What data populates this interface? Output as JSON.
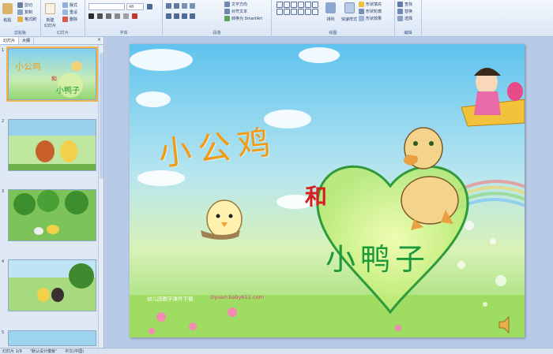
{
  "ribbon": {
    "clipboard": {
      "paste": "粘贴",
      "cut": "剪切",
      "copy": "复制",
      "format_painter": "格式刷",
      "label": "剪贴板"
    },
    "slides": {
      "new_slide": "新建\n幻灯片",
      "layout": "版式",
      "reset": "重设",
      "delete": "删除",
      "label": "幻灯片"
    },
    "font": {
      "size_value": "48",
      "label": "字体"
    },
    "paragraph": {
      "text_direction": "文字方向",
      "align_text": "对齐文本",
      "convert_smartart": "转换为 SmartArt",
      "label": "段落"
    },
    "drawing": {
      "arrange": "排列",
      "quick_styles": "快速样式",
      "shape_fill": "形状填充",
      "shape_outline": "形状轮廓",
      "shape_effects": "形状效果",
      "label": "绘图"
    },
    "editing": {
      "find": "查找",
      "replace": "替换",
      "select": "选择",
      "label": "编辑"
    }
  },
  "pane": {
    "tabs": [
      "幻灯片",
      "大纲"
    ],
    "close": "×",
    "thumbs": [
      "1",
      "2",
      "3",
      "4",
      "5"
    ]
  },
  "slide": {
    "title1": "小公鸡",
    "and": "和",
    "title2": "小鸭子",
    "footer_text": "幼儿园教学课件下载",
    "footer_url": "ziyuan.baby611.com"
  },
  "status": {
    "slide_counter": "幻灯片 1/9",
    "theme": "\"默认设计模板\"",
    "language": "中文(中国)"
  },
  "colors": {
    "title1": "#f39a12",
    "and": "#d81f1f",
    "title2": "#1c9a3b",
    "url": "#e23b8c"
  }
}
